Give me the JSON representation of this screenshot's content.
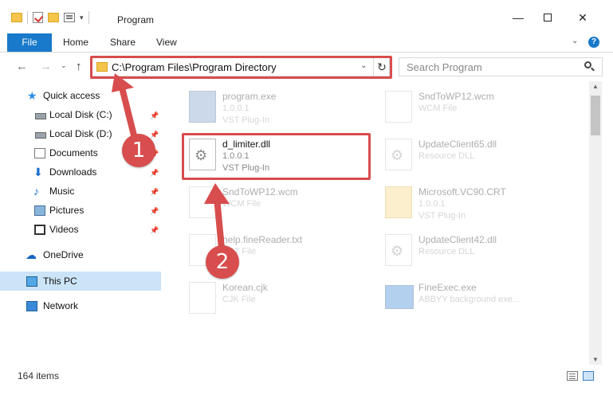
{
  "window": {
    "title": "Program",
    "controls": {
      "minimize": "—",
      "maximize": "",
      "close": "✕"
    }
  },
  "ribbon": {
    "tabs": [
      {
        "label": "File",
        "active": true
      },
      {
        "label": "Home"
      },
      {
        "label": "Share"
      },
      {
        "label": "View"
      }
    ],
    "help": "?"
  },
  "address": {
    "path": "C:\\Program Files\\Program Directory"
  },
  "search": {
    "placeholder": "Search Program"
  },
  "nav": {
    "quick_access": "Quick access",
    "items": [
      {
        "label": "Local Disk (C:)",
        "icon": "drive-icon",
        "pinned": true
      },
      {
        "label": "Local Disk (D:)",
        "icon": "drive-icon",
        "pinned": true
      },
      {
        "label": "Documents",
        "icon": "documents-icon",
        "pinned": true
      },
      {
        "label": "Downloads",
        "icon": "downloads-icon",
        "pinned": true
      },
      {
        "label": "Music",
        "icon": "music-icon",
        "pinned": true
      },
      {
        "label": "Pictures",
        "icon": "pictures-icon",
        "pinned": true
      },
      {
        "label": "Videos",
        "icon": "videos-icon",
        "pinned": true
      }
    ],
    "onedrive": "OneDrive",
    "this_pc": "This PC",
    "network": "Network"
  },
  "files": {
    "left": [
      {
        "name": "program.exe",
        "version": "1.0.0.1",
        "type": "VST Plug-In"
      },
      {
        "name": "d_limiter.dll",
        "version": "1.0.0.1",
        "type": "VST Plug-In"
      },
      {
        "name": "SndToWP12.wcm",
        "version": "",
        "type": "WCM File"
      },
      {
        "name": "help.fineReader.txt",
        "version": "",
        "type": "VST File"
      },
      {
        "name": "Korean.cjk",
        "version": "",
        "type": "CJK File"
      }
    ],
    "right": [
      {
        "name": "SndToWP12.wcm",
        "version": "",
        "type": "WCM File"
      },
      {
        "name": "UpdateClient65.dll",
        "version": "",
        "type": "Resource DLL"
      },
      {
        "name": "Microsoft.VC90.CRT",
        "version": "1.0.0.1",
        "type": "VST Plug-In"
      },
      {
        "name": "UpdateClient42.dll",
        "version": "",
        "type": "Resource DLL"
      },
      {
        "name": "FineExec.exe",
        "version": "",
        "type": "ABBYY background exe..."
      }
    ]
  },
  "status": {
    "count": "164 items"
  },
  "annotations": {
    "step1": "1",
    "step2": "2",
    "color": "#d84d4d"
  },
  "colors": {
    "accent": "#1979ca",
    "selection": "#cce4f7",
    "highlight": "#d84d4d"
  }
}
